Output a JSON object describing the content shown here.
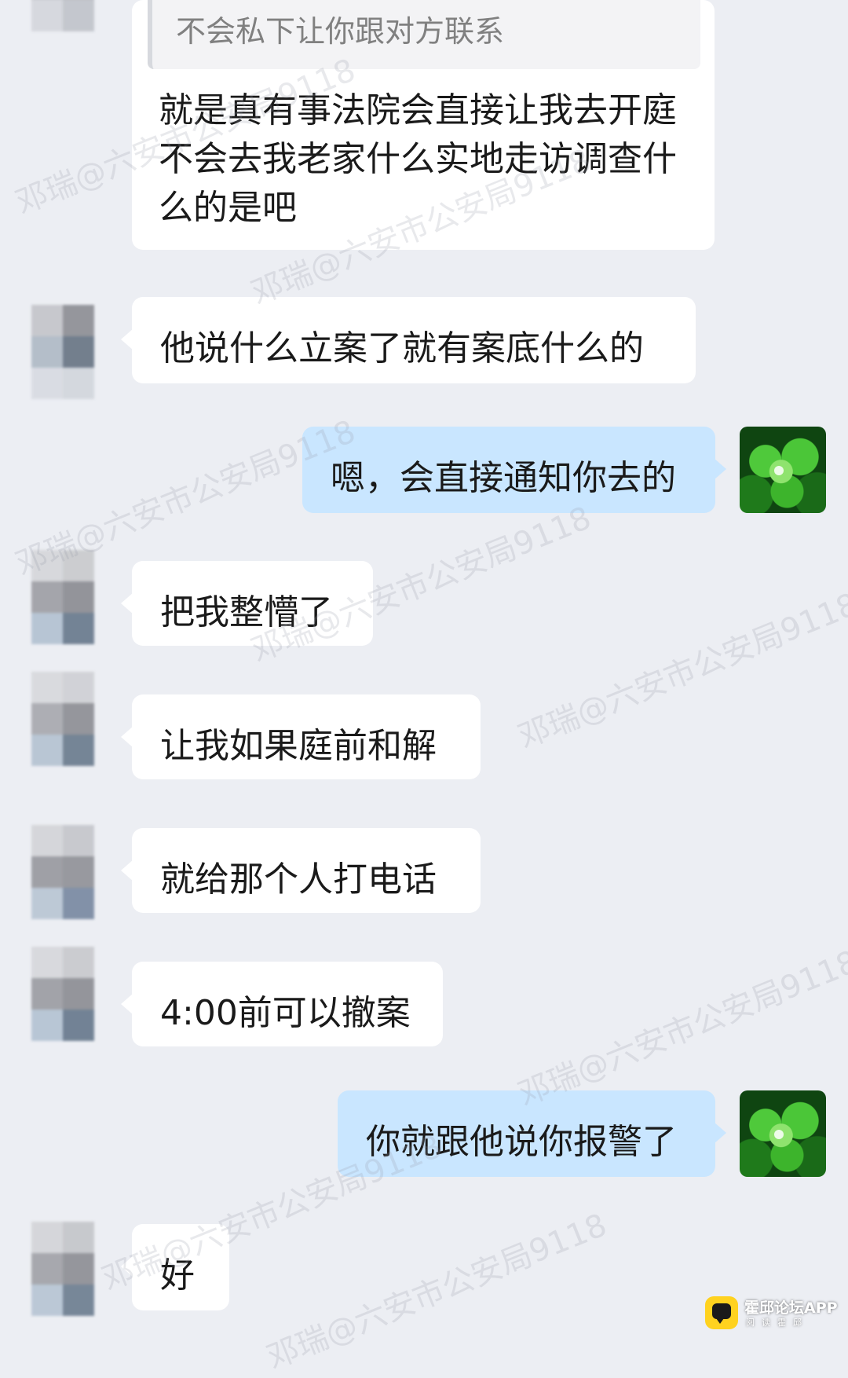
{
  "chat": {
    "quoted_reply": "不会私下让你跟对方联系",
    "messages": [
      {
        "side": "left",
        "lines": [
          "就是真有事法院会直接让我去开庭",
          "不会去我老家什么实地走访调查什",
          "么的是吧"
        ]
      },
      {
        "side": "left",
        "text": "他说什么立案了就有案底什么的"
      },
      {
        "side": "right",
        "text": "嗯，会直接通知你去的"
      },
      {
        "side": "left",
        "text": "把我整懵了"
      },
      {
        "side": "left",
        "text": "让我如果庭前和解"
      },
      {
        "side": "left",
        "text": "就给那个人打电话"
      },
      {
        "side": "left",
        "text": "4:00前可以撤案"
      },
      {
        "side": "right",
        "text": "你就跟他说你报警了"
      },
      {
        "side": "left",
        "text": "好"
      }
    ]
  },
  "watermark": {
    "text": "邓瑞@六安市公安局9118"
  },
  "app_logo": {
    "name": "霍邱论坛APP",
    "subtitle": "阅读霍邱"
  },
  "colors": {
    "background": "#eceef3",
    "bubble_left": "#ffffff",
    "bubble_right": "#c9e6ff",
    "logo_badge": "#ffd21f"
  },
  "icons": {
    "left_avatar": "blurred-mosaic-avatar",
    "right_avatar": "clover-avatar",
    "app_logo": "chat-bubble-icon"
  }
}
